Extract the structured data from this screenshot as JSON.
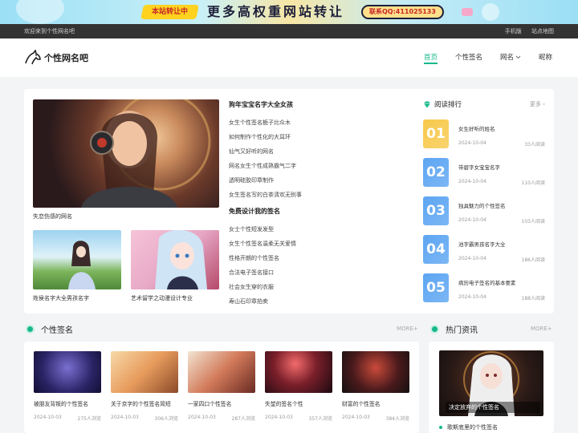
{
  "banner": {
    "tag": "本站转让中",
    "headline": "更多高权重网站转让",
    "contact": "联系QQ:411025133"
  },
  "topbar": {
    "welcome": "欢迎来到个性网名吧",
    "links": [
      "手机版",
      "站点地图"
    ]
  },
  "header": {
    "logo_text": "个性网名吧",
    "nav": [
      {
        "label": "首页",
        "active": true
      },
      {
        "label": "个性签名",
        "active": false
      },
      {
        "label": "网名",
        "active": false,
        "dropdown": true
      },
      {
        "label": "昵称",
        "active": false
      }
    ]
  },
  "featured": {
    "main_caption": "失恋伤感的网名",
    "sub1_caption": "姓侯名字大全男孩名字",
    "sub2_caption": "艺术留学之动漫设计专业"
  },
  "articles": {
    "group1_title": "狗年宝宝名字大全女孩",
    "group1_items": [
      "女生个性签名栀子比众木",
      "如何制作个性化的大耳环",
      "仙气又好听的网名",
      "网名女生个性成熟霸气二字",
      "透明硅胶印章制作",
      "女生签名写的白茶清欢无别事"
    ],
    "group2_title": "免费设计我的签名",
    "group2_items": [
      "女士个性短发发型",
      "女生个性签名温柔无关爱情",
      "性格开朗的个性签名",
      "合法电子签名接口",
      "社会女生穿的衣服",
      "寿山石印章拍卖"
    ]
  },
  "ranking": {
    "title": "阅读排行",
    "more": "更多",
    "items": [
      {
        "num": "01",
        "title": "女生好听的姓名",
        "date": "2024-10-04",
        "views": "33人阅读",
        "color": "#f7c84a"
      },
      {
        "num": "02",
        "title": "带碧字女宝宝名字",
        "date": "2024-10-04",
        "views": "110人阅读",
        "color": "#5ca5f2"
      },
      {
        "num": "03",
        "title": "独具魅力的个性签名",
        "date": "2024-10-04",
        "views": "103人阅读",
        "color": "#5ca5f2"
      },
      {
        "num": "04",
        "title": "池字霸男孩名字大全",
        "date": "2024-10-04",
        "views": "186人阅读",
        "color": "#5ca5f2"
      },
      {
        "num": "05",
        "title": "病历电子签名的基本要素",
        "date": "2024-10-04",
        "views": "188人阅读",
        "color": "#5ca5f2"
      }
    ]
  },
  "signatures": {
    "title": "个性签名",
    "more": "MORE+",
    "items": [
      {
        "title": "被朋友背叛的个性签名",
        "date": "2024-10-03",
        "views": "275人浏览"
      },
      {
        "title": "关于京字的个性签名简短",
        "date": "2024-10-03",
        "views": "306人浏览"
      },
      {
        "title": "一家四口个性签名",
        "date": "2024-10-03",
        "views": "287人浏览"
      },
      {
        "title": "失望的签名个性",
        "date": "2024-10-03",
        "views": "357人浏览"
      },
      {
        "title": "财富的个性签名",
        "date": "2024-10-03",
        "views": "384人浏览"
      }
    ]
  },
  "hot": {
    "title": "热门资讯",
    "more": "MORE+",
    "image_caption": "决定放弃的个性签名",
    "first_item": "歌斯底里的个性签名"
  },
  "colors": {
    "accent": "#16b88a",
    "topbar": "#333333"
  }
}
